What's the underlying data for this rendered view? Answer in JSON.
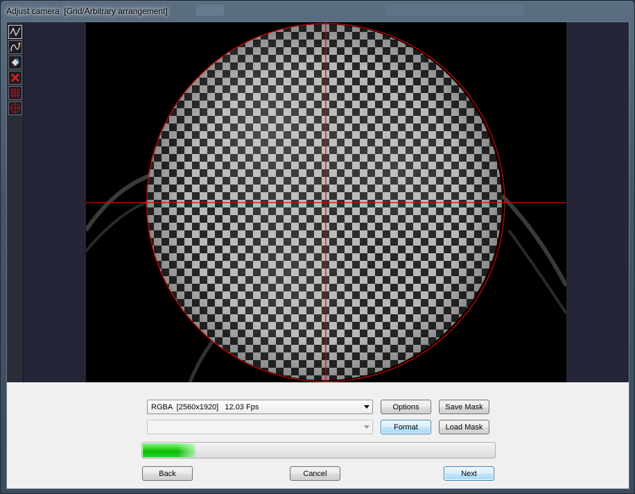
{
  "window": {
    "title": "Adjust camera  [Grid/Arbitrary arrangement]"
  },
  "toolbar": {
    "tools": [
      {
        "icon": "curve-line-icon"
      },
      {
        "icon": "freehand-curve-icon"
      },
      {
        "icon": "fill-bucket-icon"
      },
      {
        "icon": "delete-x-icon",
        "color": "#e11b1b"
      },
      {
        "icon": "grid-icon",
        "color": "#b01818"
      },
      {
        "icon": "circle-crosshair-icon",
        "color": "#b01818"
      }
    ]
  },
  "viewer": {
    "overlay_color": "#e00000"
  },
  "controls": {
    "format_select": {
      "value": "RGBA  [2560x1920]   12.03 Fps"
    },
    "secondary_select": {
      "value": ""
    },
    "options_button": "Options",
    "save_mask_button": "Save Mask",
    "format_button": "Format",
    "load_mask_button": "Load Mask",
    "progress": {
      "fraction": 0.15
    },
    "back_button": "Back",
    "cancel_button": "Cancel",
    "next_button": "Next"
  }
}
